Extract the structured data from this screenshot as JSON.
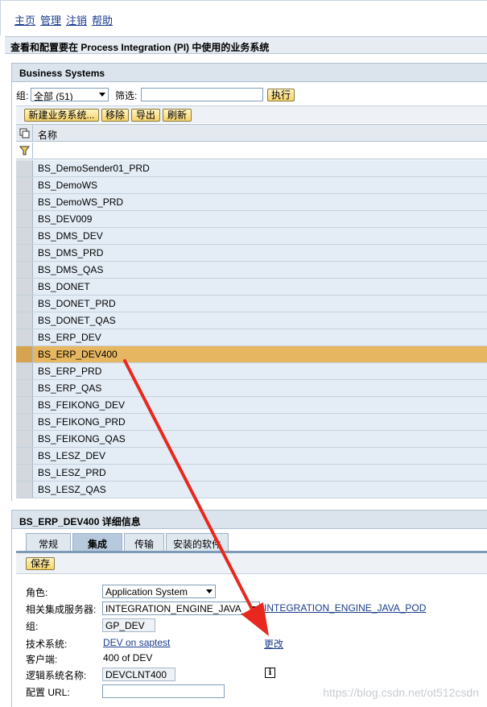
{
  "nav": {
    "home": "主页",
    "manage": "管理",
    "logout": "注销",
    "help": "帮助"
  },
  "page_title": "查看和配置要在 Process Integration (PI) 中使用的业务系统",
  "business_systems": {
    "header": "Business Systems",
    "group_label": "组:",
    "group_value": "全部 (51)",
    "filter_label": "筛选:",
    "filter_value": "",
    "execute": "执行",
    "toolbar": {
      "new": "新建业务系统...",
      "remove": "移除",
      "export": "导出",
      "refresh": "刷新"
    },
    "col_name": "名称",
    "rows": [
      "BS_DemoSender01_PRD",
      "BS_DemoWS",
      "BS_DemoWS_PRD",
      "BS_DEV009",
      "BS_DMS_DEV",
      "BS_DMS_PRD",
      "BS_DMS_QAS",
      "BS_DONET",
      "BS_DONET_PRD",
      "BS_DONET_QAS",
      "BS_ERP_DEV",
      "BS_ERP_DEV400",
      "BS_ERP_PRD",
      "BS_ERP_QAS",
      "BS_FEIKONG_DEV",
      "BS_FEIKONG_PRD",
      "BS_FEIKONG_QAS",
      "BS_LESZ_DEV",
      "BS_LESZ_PRD",
      "BS_LESZ_QAS"
    ],
    "selected_row": "BS_ERP_DEV400"
  },
  "detail": {
    "header": "BS_ERP_DEV400 详细信息",
    "tabs": [
      "常规",
      "集成",
      "传输",
      "安装的软件"
    ],
    "active_tab": "集成",
    "save": "保存",
    "role_label": "角色:",
    "role_value": "Application System",
    "server_label": "相关集成服务器:",
    "server_value": "INTEGRATION_ENGINE_JAVA_",
    "server_link": "INTEGRATION_ENGINE_JAVA_POD",
    "group_label": "组:",
    "group_value": "GP_DEV",
    "tech_label": "技术系统:",
    "tech_link": "DEV on saptest",
    "change_link": "更改",
    "client_label": "客户端:",
    "client_value": "400 of DEV",
    "logical_label": "逻辑系统名称:",
    "logical_value": "DEVCLNT400",
    "info_icon": "i",
    "url_label": "配置 URL:",
    "url_value": ""
  },
  "annotation": {
    "color": "#e8281f"
  },
  "watermark": "https://blog.csdn.net/ot512csdn"
}
